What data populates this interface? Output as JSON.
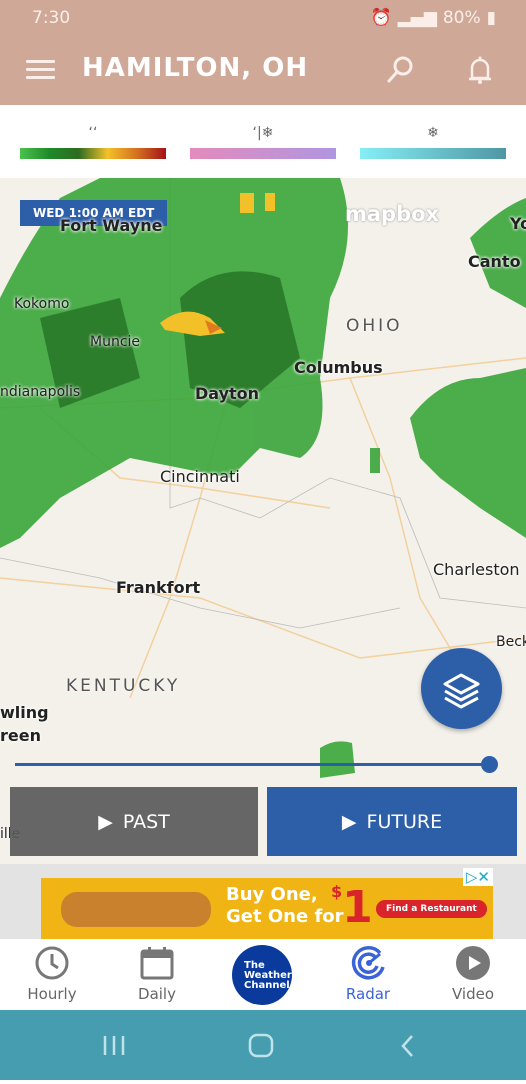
{
  "status_bar": {
    "time": "7:30",
    "battery": "80%",
    "network": "4G"
  },
  "app_bar": {
    "title": "HAMILTON, OH",
    "icons": [
      "menu-icon",
      "search-icon",
      "bell-icon"
    ]
  },
  "legend": {
    "items": [
      {
        "icon": "rain-icon",
        "gradient": [
          "#4cc14c",
          "#1f8a2a",
          "#2d6b22",
          "#f4c12a",
          "#d4711f",
          "#a3121a"
        ]
      },
      {
        "icon": "mix-icon",
        "gradient": [
          "#e38bbd",
          "#b096e0"
        ]
      },
      {
        "icon": "snow-icon",
        "gradient": [
          "#86eef5",
          "#4f97a4"
        ]
      }
    ]
  },
  "map": {
    "timestamp": "WED 1:00 AM EDT",
    "attribution": "mapbox",
    "cities": [
      "Fort Wayne",
      "Kokomo",
      "Muncie",
      "Indianapolis",
      "Dayton",
      "Columbus",
      "Cincinnati",
      "Frankfort",
      "Charleston",
      "Canton",
      "Beckley",
      "Bowling Green",
      "Louisville"
    ],
    "city_fragments": {
      "indianapolis": "ndianapolis",
      "canton": "Canto",
      "beckley": "Beck",
      "bowling_green_1": "wling",
      "bowling_green_2": "reen",
      "louisville": "ille",
      "youngstown": "Yo"
    },
    "regions": [
      "OHIO",
      "KENTUCKY"
    ],
    "precip_color": "#3aa53a"
  },
  "timeline": {
    "progress": 1.0
  },
  "controls": {
    "past_label": "PAST",
    "future_label": "FUTURE",
    "accent": "#2d5ea8"
  },
  "ad": {
    "line1": "Buy One,",
    "line2": "Get One for",
    "price_symbol": "$",
    "price": "1",
    "cta": "Find a Restaurant"
  },
  "bottom_nav": {
    "items": [
      {
        "label": "Hourly",
        "icon": "clock-icon",
        "active": false
      },
      {
        "label": "Daily",
        "icon": "calendar-icon",
        "active": false
      },
      {
        "label": "The Weather Channel",
        "icon": "twc-logo",
        "active": false
      },
      {
        "label": "Radar",
        "icon": "radar-icon",
        "active": true
      },
      {
        "label": "Video",
        "icon": "play-icon",
        "active": false
      }
    ]
  }
}
